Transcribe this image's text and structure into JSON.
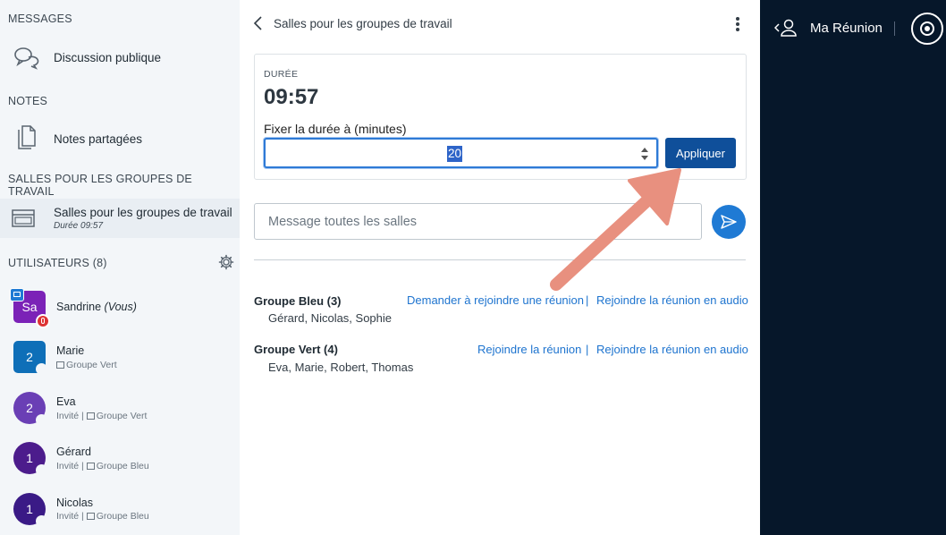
{
  "sidebar": {
    "messages_title": "MESSAGES",
    "public_chat": "Discussion publique",
    "notes_title": "NOTES",
    "shared_notes": "Notes partagées",
    "breakout_title": "SALLES POUR LES GROUPES DE TRAVAIL",
    "breakout_item": "Salles pour les groupes de travail",
    "breakout_sub": "Durée 09:57",
    "users_title": "UTILISATEURS (8)",
    "users": [
      {
        "initials": "Sa",
        "name": "Sandrine",
        "suffix": "(Vous)",
        "role": "",
        "room": "",
        "color": "#7b22b7"
      },
      {
        "initials": "2",
        "name": "Marie",
        "role": "",
        "room": "Groupe Vert",
        "color": "#0e6fb8"
      },
      {
        "initials": "2",
        "name": "Eva",
        "role": "Invité |",
        "room": "Groupe Vert",
        "color": "#6a3fb5"
      },
      {
        "initials": "1",
        "name": "Gérard",
        "role": "Invité |",
        "room": "Groupe Bleu",
        "color": "#4c1c8c"
      },
      {
        "initials": "1",
        "name": "Nicolas",
        "role": "Invité |",
        "room": "Groupe Bleu",
        "color": "#3a1a86"
      }
    ]
  },
  "panel": {
    "title": "Salles pour les groupes de travail",
    "duration_label": "DURÉE",
    "duration_value": "09:57",
    "set_duration_label": "Fixer la durée à (minutes)",
    "duration_input": "20",
    "apply_label": "Appliquer",
    "message_placeholder": "Message toutes les salles",
    "groups": [
      {
        "name": "Groupe Bleu (3)",
        "members": "Gérard, Nicolas, Sophie",
        "link1": "Demander à rejoindre une réunion",
        "link2": "Rejoindre la réunion en audio"
      },
      {
        "name": "Groupe Vert (4)",
        "members": "Eva, Marie, Robert, Thomas",
        "link1": "Rejoindre la réunion",
        "link2": "Rejoindre la réunion en audio"
      }
    ],
    "separator": "|"
  },
  "right_panel": {
    "title": "Ma Réunion"
  },
  "colors": {
    "accent": "#1e74cf",
    "apply_button": "#0f4f9a",
    "dark_panel": "#06172a",
    "annotation_arrow": "#e8907f"
  }
}
